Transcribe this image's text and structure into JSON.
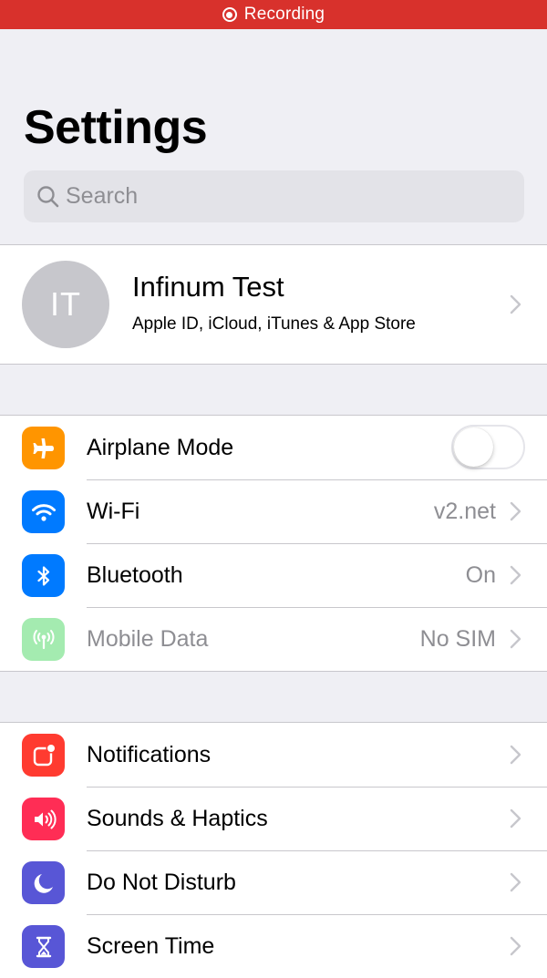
{
  "status_bar": {
    "recording_label": "Recording",
    "color": "#d8312c"
  },
  "header": {
    "title": "Settings"
  },
  "search": {
    "placeholder": "Search",
    "value": ""
  },
  "profile": {
    "initials": "IT",
    "name": "Infinum Test",
    "subtitle": "Apple ID, iCloud, iTunes & App Store"
  },
  "connectivity": {
    "items": [
      {
        "label": "Airplane Mode",
        "icon": "airplane-icon",
        "color": "#ff9500",
        "toggle_on": false
      },
      {
        "label": "Wi-Fi",
        "icon": "wifi-icon",
        "color": "#007aff",
        "value": "v2.net"
      },
      {
        "label": "Bluetooth",
        "icon": "bluetooth-icon",
        "color": "#007aff",
        "value": "On"
      },
      {
        "label": "Mobile Data",
        "icon": "antenna-icon",
        "color": "#4cd964",
        "value": "No SIM",
        "disabled": true
      }
    ]
  },
  "general": {
    "items": [
      {
        "label": "Notifications",
        "icon": "notifications-icon",
        "color": "#ff3b30"
      },
      {
        "label": "Sounds & Haptics",
        "icon": "speaker-icon",
        "color": "#ff2d55"
      },
      {
        "label": "Do Not Disturb",
        "icon": "moon-icon",
        "color": "#5856d6"
      },
      {
        "label": "Screen Time",
        "icon": "hourglass-icon",
        "color": "#5856d6"
      }
    ]
  }
}
